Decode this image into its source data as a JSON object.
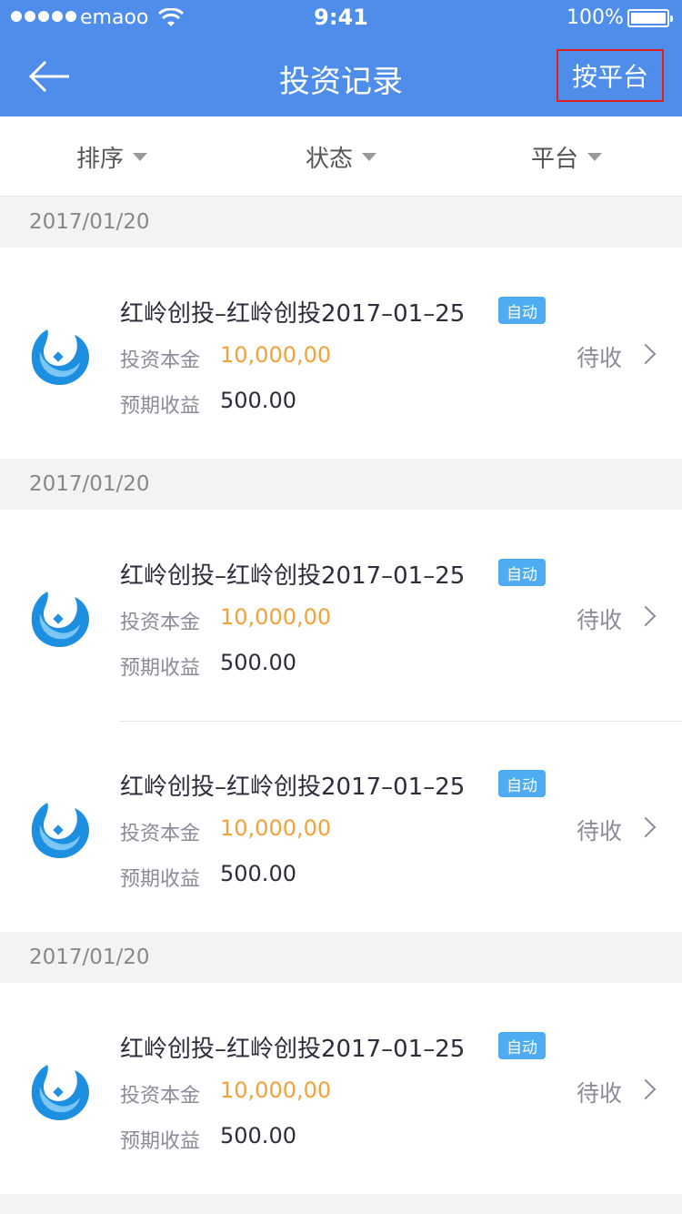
{
  "status_bar": {
    "carrier": "emaoo",
    "time": "9:41",
    "battery": "100%"
  },
  "nav": {
    "title": "投资记录",
    "platform_button": "按平台",
    "back_icon": "arrow-left-icon"
  },
  "filters": [
    {
      "label": "排序"
    },
    {
      "label": "状态"
    },
    {
      "label": "平台"
    }
  ],
  "groups": [
    {
      "date": "2017/01/20",
      "items": [
        {
          "title": "红岭创投–红岭创投2017–01–25",
          "badge": "自动",
          "principal_label": "投资本金",
          "principal": "10,000,00",
          "income_label": "预期收益",
          "income": "500.00",
          "status": "待收"
        }
      ]
    },
    {
      "date": "2017/01/20",
      "items": [
        {
          "title": "红岭创投–红岭创投2017–01–25",
          "badge": "自动",
          "principal_label": "投资本金",
          "principal": "10,000,00",
          "income_label": "预期收益",
          "income": "500.00",
          "status": "待收"
        },
        {
          "title": "红岭创投–红岭创投2017–01–25",
          "badge": "自动",
          "principal_label": "投资本金",
          "principal": "10,000,00",
          "income_label": "预期收益",
          "income": "500.00",
          "status": "待收"
        }
      ]
    },
    {
      "date": "2017/01/20",
      "items": [
        {
          "title": "红岭创投–红岭创投2017–01–25",
          "badge": "自动",
          "principal_label": "投资本金",
          "principal": "10,000,00",
          "income_label": "预期收益",
          "income": "500.00",
          "status": "待收"
        }
      ]
    }
  ],
  "colors": {
    "header": "#4e8de9",
    "principal": "#f5a13a",
    "badge": "#4dadf0",
    "highlight_border": "#e0201c"
  }
}
